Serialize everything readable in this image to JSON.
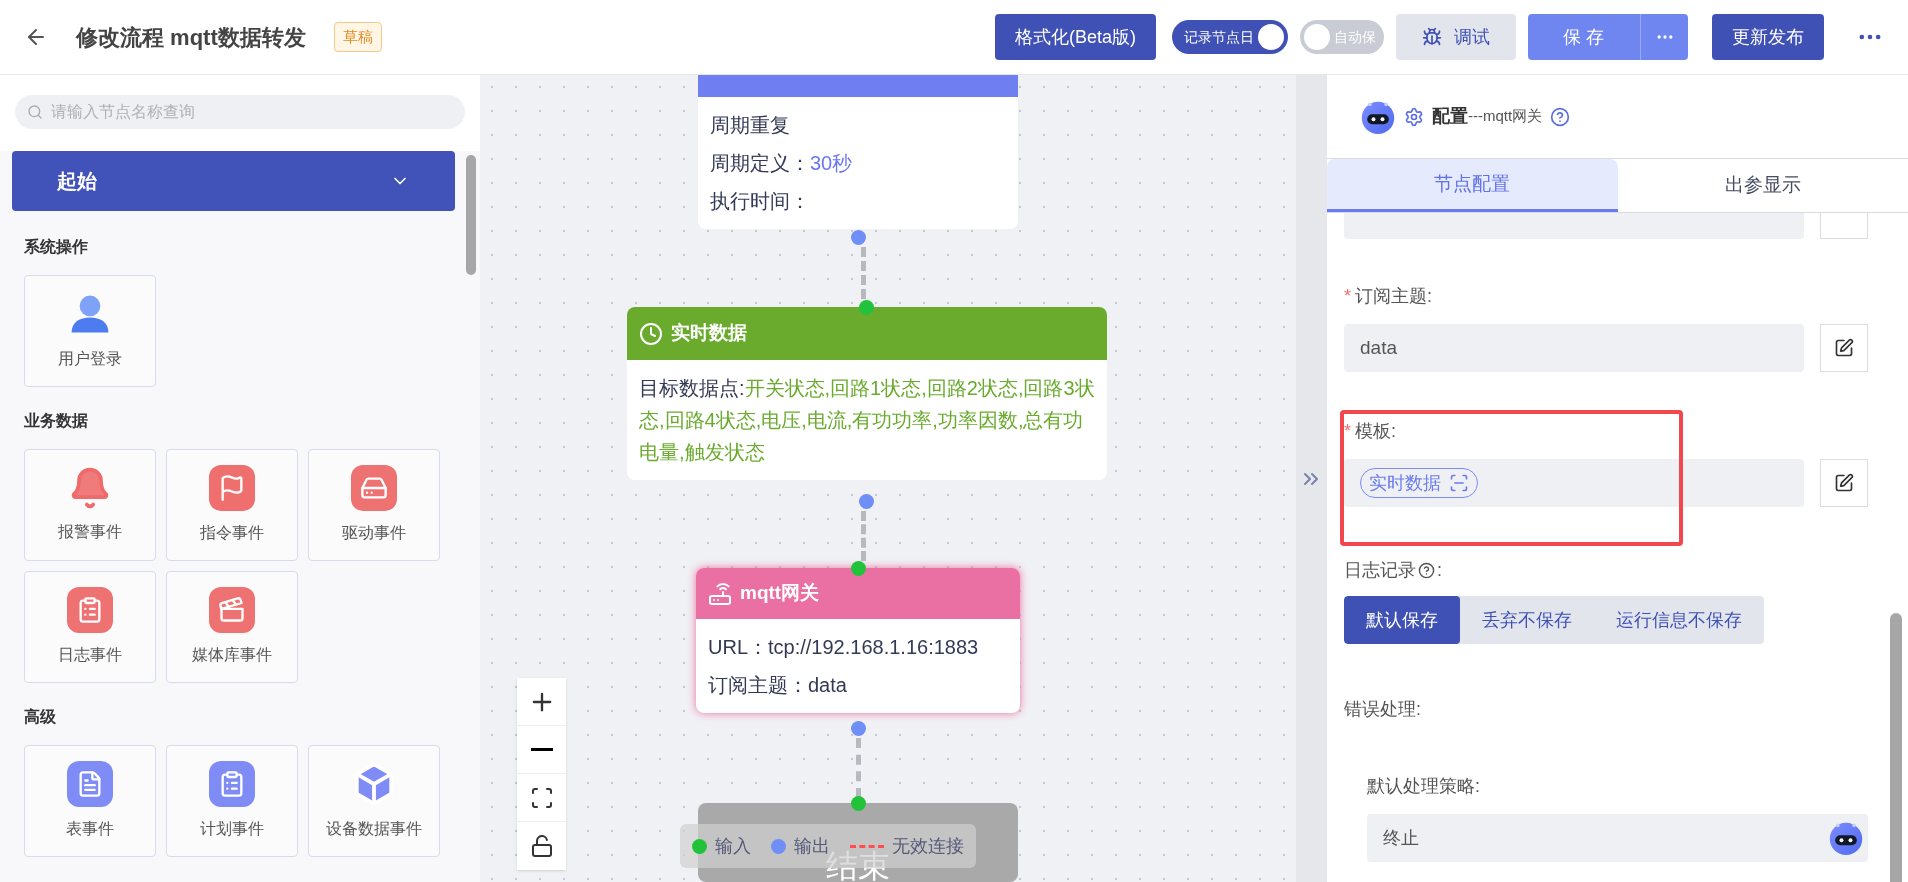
{
  "header": {
    "title": "修改流程 mqtt数据转发",
    "badge": "草稿",
    "format_button": "格式化(Beta版)",
    "toggles": [
      {
        "label": "记录节点日",
        "on": true
      },
      {
        "label": "自动保",
        "on": false
      }
    ],
    "debug_button": "调试",
    "save_button": "保 存",
    "publish_button": "更新发布"
  },
  "sidebar": {
    "search_placeholder": "请输入节点名称查询",
    "category": {
      "label": "起始",
      "expanded": true
    },
    "sections": [
      {
        "title": "系统操作",
        "items": [
          "用户登录"
        ]
      },
      {
        "title": "业务数据",
        "items": [
          "报警事件",
          "指令事件",
          "驱动事件",
          "日志事件",
          "媒体库事件"
        ]
      },
      {
        "title": "高级",
        "items": [
          "表事件",
          "计划事件",
          "设备数据事件"
        ]
      }
    ]
  },
  "canvas": {
    "nodes": [
      {
        "kind": "timer",
        "lines": [
          {
            "label": "周期重复"
          },
          {
            "label": "周期定义：",
            "value": "30秒"
          },
          {
            "label": "执行时间："
          }
        ]
      },
      {
        "kind": "data",
        "title": "实时数据",
        "lines": [
          {
            "label": "目标数据点:",
            "value": "开关状态,回路1状态,回路2状态,回路3状态,回路4状态,电压,电流,有功功率,功率因数,总有功电量,触发状态"
          }
        ]
      },
      {
        "kind": "mqtt",
        "title": "mqtt网关",
        "lines": [
          {
            "label": "URL：",
            "value": "tcp://192.168.1.16:1883"
          },
          {
            "label": "订阅主题：",
            "value": "data"
          }
        ]
      },
      {
        "kind": "end",
        "title": "结束"
      }
    ],
    "legend": [
      {
        "kind": "input",
        "label": "输入"
      },
      {
        "kind": "output",
        "label": "输出"
      },
      {
        "kind": "invalid",
        "label": "无效连接"
      }
    ]
  },
  "panel": {
    "title": "配置",
    "subtitle": "---mqtt网关",
    "tabs": [
      {
        "label": "节点配置",
        "selected": true
      },
      {
        "label": "出参显示",
        "selected": false
      }
    ],
    "topic_field": {
      "required_mark": "*",
      "label": "订阅主题:",
      "value": "data"
    },
    "template_field": {
      "required_mark": "*",
      "label": "模板:",
      "chip": "实时数据",
      "highlighted": true
    },
    "log_label": "日志记录",
    "log_colon": ":",
    "log_options": [
      {
        "label": "默认保存",
        "selected": true
      },
      {
        "label": "丢弃不保存",
        "selected": false
      },
      {
        "label": "运行信息不保存",
        "selected": false
      }
    ],
    "error_label": "错误处理:",
    "strategy_label": "默认处理策略:",
    "strategy_value": "终止"
  }
}
